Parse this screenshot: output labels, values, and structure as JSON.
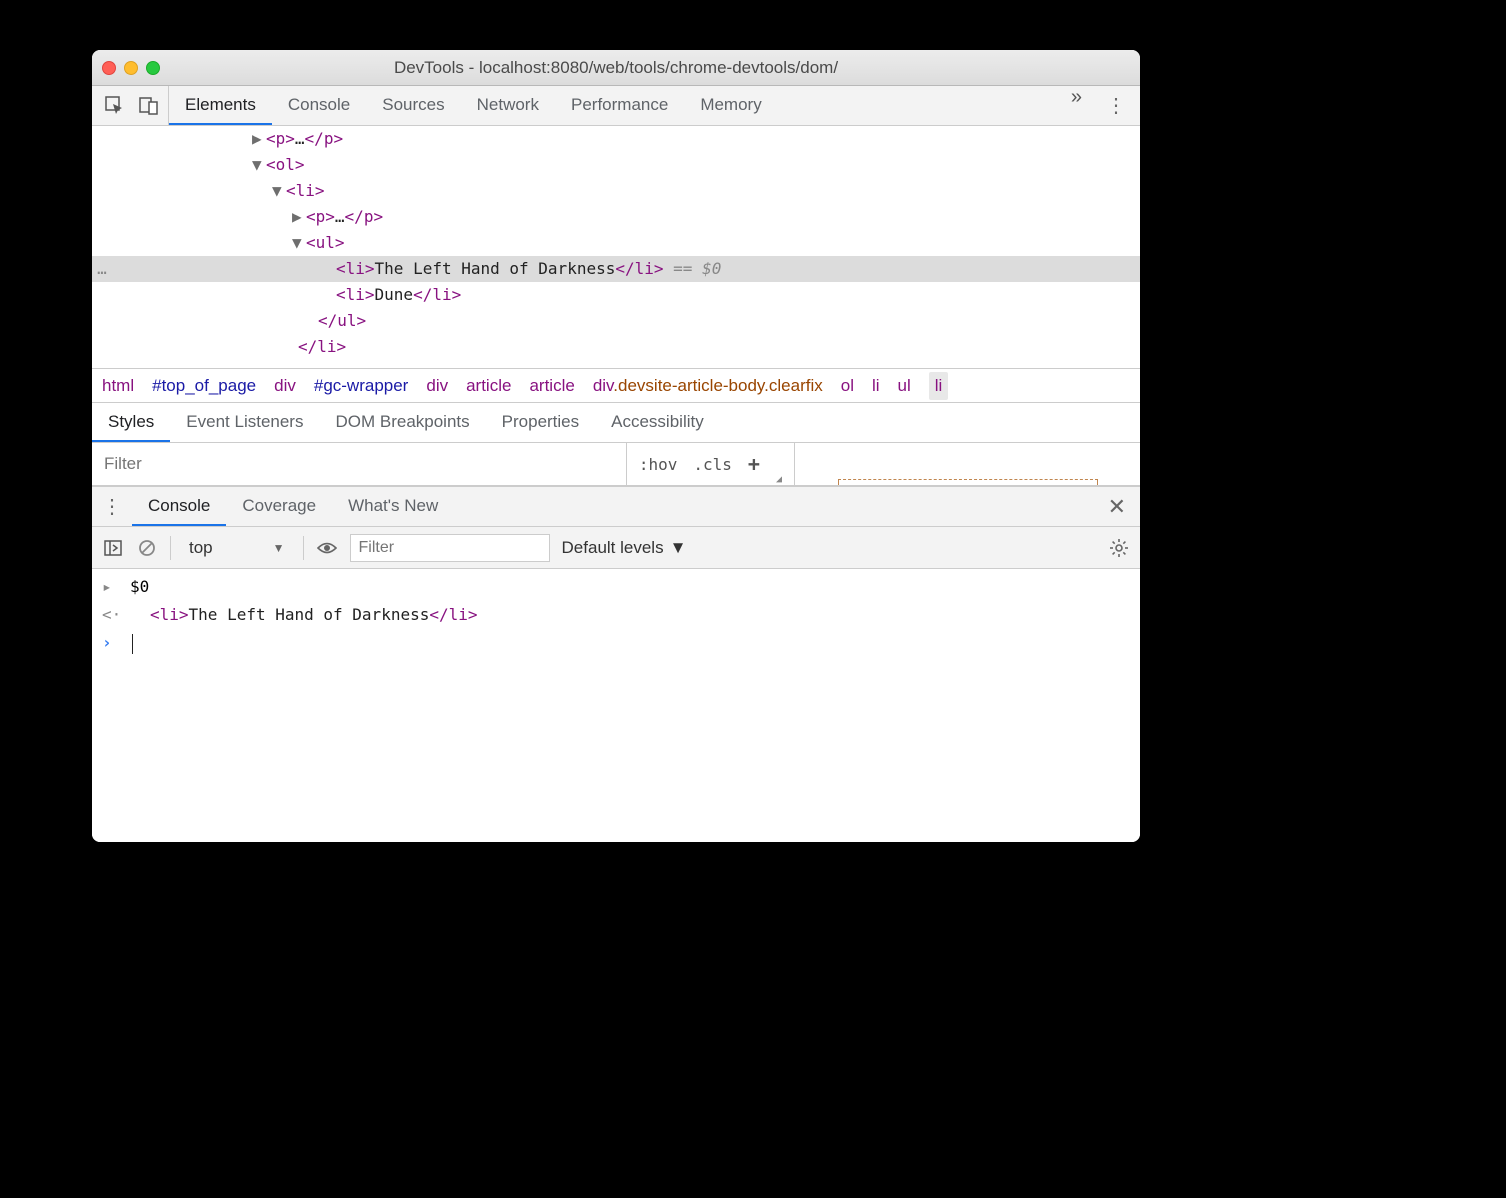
{
  "window": {
    "title": "DevTools - localhost:8080/web/tools/chrome-devtools/dom/"
  },
  "mainTabs": [
    "Elements",
    "Console",
    "Sources",
    "Network",
    "Performance",
    "Memory"
  ],
  "activeMainTab": "Elements",
  "domTree": {
    "lines": [
      {
        "indent": 160,
        "arrow": "▶",
        "parts": [
          {
            "t": "tag",
            "v": "<p>"
          },
          {
            "t": "txt",
            "v": "…"
          },
          {
            "t": "tag",
            "v": "</p>"
          }
        ]
      },
      {
        "indent": 160,
        "arrow": "▼",
        "parts": [
          {
            "t": "tag",
            "v": "<ol>"
          }
        ]
      },
      {
        "indent": 180,
        "arrow": "▼",
        "parts": [
          {
            "t": "tag",
            "v": "<li>"
          }
        ]
      },
      {
        "indent": 200,
        "arrow": "▶",
        "parts": [
          {
            "t": "tag",
            "v": "<p>"
          },
          {
            "t": "txt",
            "v": "…"
          },
          {
            "t": "tag",
            "v": "</p>"
          }
        ]
      },
      {
        "indent": 200,
        "arrow": "▼",
        "parts": [
          {
            "t": "tag",
            "v": "<ul>"
          }
        ]
      },
      {
        "indent": 230,
        "arrow": "",
        "selected": true,
        "parts": [
          {
            "t": "tag",
            "v": "<li>"
          },
          {
            "t": "txt",
            "v": "The Left Hand of Darkness"
          },
          {
            "t": "tag",
            "v": "</li>"
          },
          {
            "t": "eq",
            "v": " == $0"
          }
        ]
      },
      {
        "indent": 230,
        "arrow": "",
        "parts": [
          {
            "t": "tag",
            "v": "<li>"
          },
          {
            "t": "txt",
            "v": "Dune"
          },
          {
            "t": "tag",
            "v": "</li>"
          }
        ]
      },
      {
        "indent": 212,
        "arrow": "",
        "parts": [
          {
            "t": "tag",
            "v": "</ul>"
          }
        ]
      },
      {
        "indent": 192,
        "arrow": "",
        "parts": [
          {
            "t": "tag",
            "v": "</li>"
          }
        ]
      }
    ],
    "gutterSelected": "…"
  },
  "breadcrumb": [
    {
      "text": "html",
      "type": "tag"
    },
    {
      "text": "#top_of_page",
      "type": "id"
    },
    {
      "text": "div",
      "type": "tag"
    },
    {
      "text": "#gc-wrapper",
      "type": "id"
    },
    {
      "text": "div",
      "type": "tag"
    },
    {
      "text": "article",
      "type": "tag"
    },
    {
      "text": "article",
      "type": "tag"
    },
    {
      "text": "div",
      "cls": ".devsite-article-body.clearfix",
      "type": "tagcls"
    },
    {
      "text": "ol",
      "type": "tag"
    },
    {
      "text": "li",
      "type": "tag"
    },
    {
      "text": "ul",
      "type": "tag"
    },
    {
      "text": "li",
      "type": "tag",
      "last": true
    }
  ],
  "sidebarTabs": [
    "Styles",
    "Event Listeners",
    "DOM Breakpoints",
    "Properties",
    "Accessibility"
  ],
  "activeSidebarTab": "Styles",
  "stylesFilter": {
    "placeholder": "Filter"
  },
  "styleButtons": {
    "hov": ":hov",
    "cls": ".cls",
    "plus": "+"
  },
  "drawerTabs": [
    "Console",
    "Coverage",
    "What's New"
  ],
  "activeDrawerTab": "Console",
  "consoleToolbar": {
    "context": "top",
    "filterPlaceholder": "Filter",
    "levels": "Default levels"
  },
  "consoleRows": [
    {
      "icon": "expand",
      "content": "$0"
    },
    {
      "icon": "return",
      "html": [
        {
          "t": "tag",
          "v": "<li>"
        },
        {
          "t": "txt",
          "v": "The Left Hand of Darkness"
        },
        {
          "t": "tag",
          "v": "</li>"
        }
      ]
    },
    {
      "icon": "prompt",
      "content": ""
    }
  ]
}
